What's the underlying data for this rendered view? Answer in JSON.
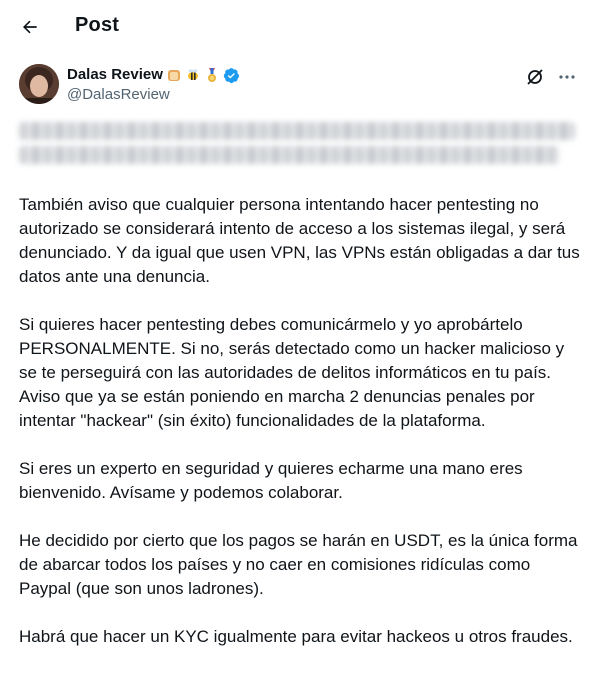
{
  "header": {
    "title": "Post",
    "back_label": "Back"
  },
  "author": {
    "display_name": "Dalas Review",
    "handle": "@DalasReview",
    "badges": [
      "bread-emoji",
      "bee-emoji",
      "medal-emoji",
      "verified-badge"
    ],
    "verified_color": "#1d9bf0"
  },
  "post": {
    "paragraphs": [
      "También aviso que cualquier persona intentando hacer pentesting no autorizado se considerará intento de acceso a los sistemas ilegal, y será denunciado. Y da igual que usen VPN, las VPNs están obligadas a dar tus datos ante una denuncia.",
      "Si quieres hacer pentesting debes comunicármelo y yo aprobártelo PERSONALMENTE. Si no, serás detectado como un hacker malicioso y se te perseguirá con las autoridades de delitos informáticos en tu país. Aviso que ya se están poniendo en marcha 2 denuncias penales por intentar \"hackear\" (sin éxito) funcionalidades de la plataforma.",
      "Si eres un experto en seguridad y quieres echarme una mano eres bienvenido. Avísame y podemos colaborar.",
      "He decidido por cierto que los pagos se harán en USDT, es la única forma de abarcar todos los países y no caer en comisiones ridículas como Paypal (que son unos ladrones).",
      "Habrá que hacer un KYC igualmente para evitar hackeos u otros fraudes."
    ]
  },
  "colors": {
    "text": "#0f1419",
    "secondary": "#536471",
    "accent": "#1d9bf0"
  }
}
